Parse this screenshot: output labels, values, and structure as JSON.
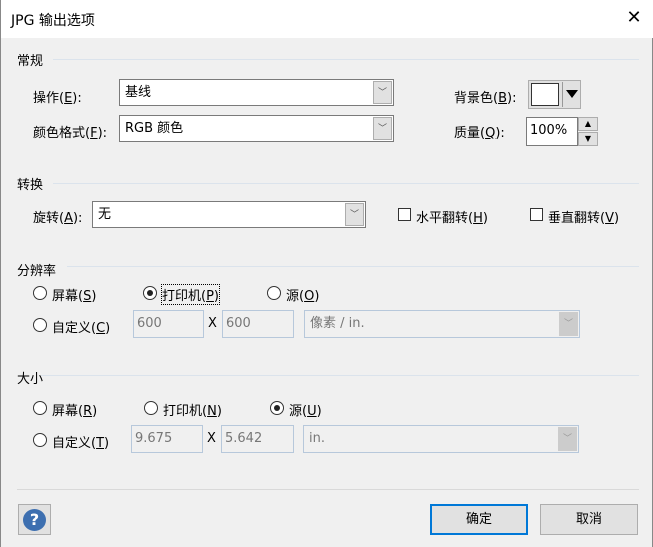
{
  "window": {
    "title": "JPG 输出选项",
    "close_icon": "close-icon"
  },
  "general": {
    "title": "常规",
    "operation": {
      "label": "操作(E):",
      "value": "基线"
    },
    "color_format": {
      "label": "颜色格式(F):",
      "value": "RGB 颜色"
    },
    "background": {
      "label": "背景色(B):",
      "color": "#ffffff"
    },
    "quality": {
      "label": "质量(Q):",
      "value": "100%"
    }
  },
  "transform": {
    "title": "转换",
    "rotation": {
      "label": "旋转(A):",
      "value": "无"
    },
    "flip_h": {
      "label": "水平翻转(H)",
      "checked": false
    },
    "flip_v": {
      "label": "垂直翻转(V)",
      "checked": false
    }
  },
  "resolution": {
    "title": "分辨率",
    "options": [
      "屏幕(S)",
      "打印机(P)",
      "源(O)",
      "自定义(C)"
    ],
    "selected": "打印机(P)",
    "width": "600",
    "x": "X",
    "height": "600",
    "unit": "像素 / in."
  },
  "size": {
    "title": "大小",
    "options": [
      "屏幕(R)",
      "打印机(N)",
      "源(U)",
      "自定义(T)"
    ],
    "selected": "源(U)",
    "width": "9.675",
    "x": "X",
    "height": "5.642",
    "unit": "in."
  },
  "footer": {
    "help": "?",
    "ok": "确定",
    "cancel": "取消"
  }
}
